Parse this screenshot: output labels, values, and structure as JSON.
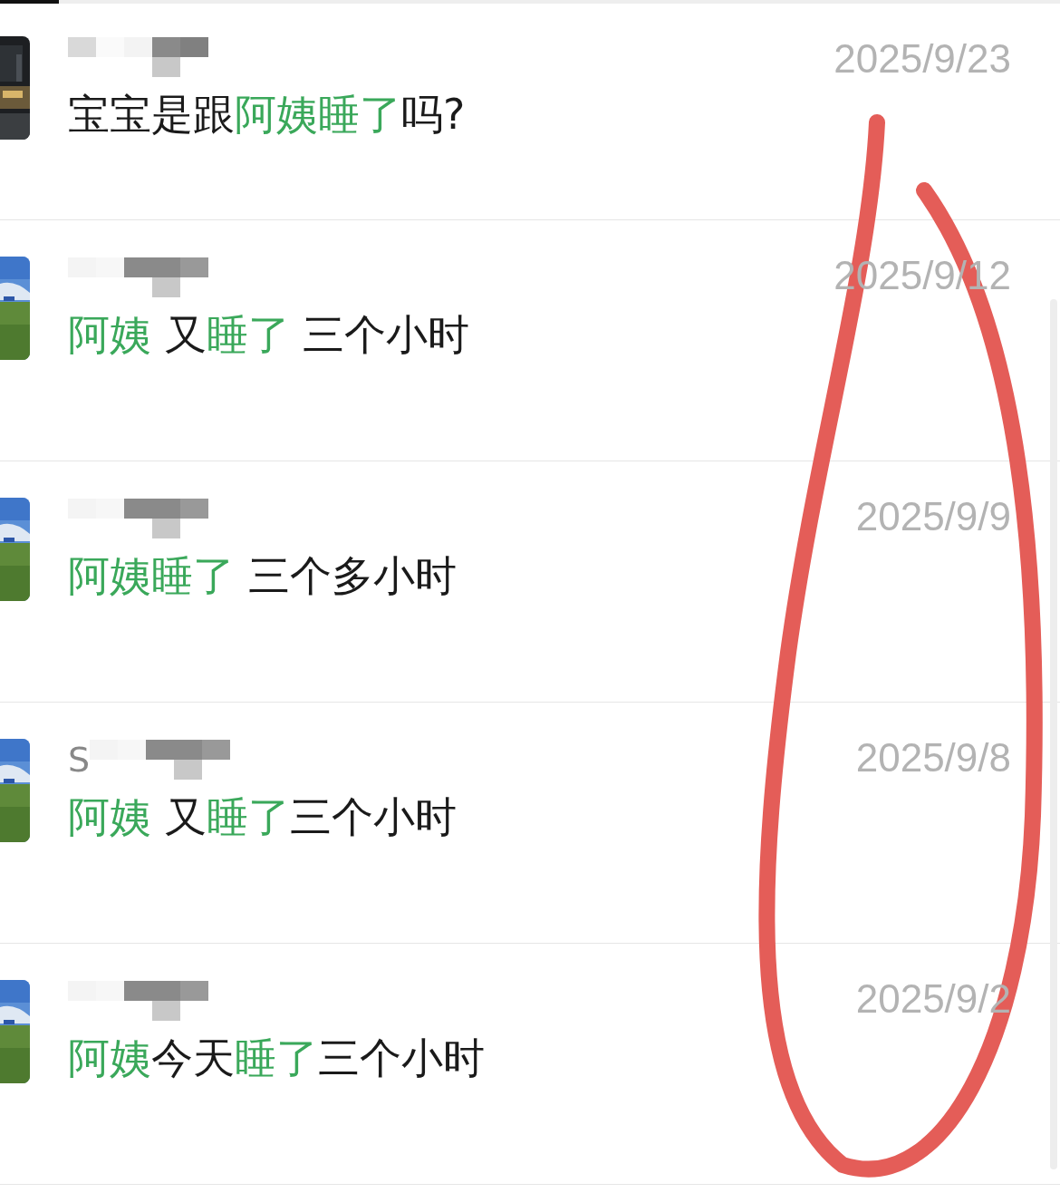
{
  "results": [
    {
      "avatar": {
        "kind": "night"
      },
      "date": "2025/9/23",
      "message": [
        {
          "text": "宝宝是跟",
          "highlight": false
        },
        {
          "text": "阿姨睡了",
          "highlight": true
        },
        {
          "text": "吗?",
          "highlight": false
        }
      ]
    },
    {
      "avatar": {
        "kind": "field"
      },
      "date": "2025/9/12",
      "message": [
        {
          "text": "阿姨",
          "highlight": true
        },
        {
          "text": " 又",
          "highlight": false
        },
        {
          "text": "睡了",
          "highlight": true
        },
        {
          "text": " 三个小时",
          "highlight": false
        }
      ]
    },
    {
      "avatar": {
        "kind": "field"
      },
      "date": "2025/9/9",
      "message": [
        {
          "text": "阿姨睡了",
          "highlight": true
        },
        {
          "text": " 三个多小时",
          "highlight": false
        }
      ]
    },
    {
      "avatar": {
        "kind": "field"
      },
      "name": "S",
      "date": "2025/9/8",
      "message": [
        {
          "text": "阿姨",
          "highlight": true
        },
        {
          "text": " 又",
          "highlight": false
        },
        {
          "text": "睡了",
          "highlight": true
        },
        {
          "text": "三个小时",
          "highlight": false
        }
      ]
    },
    {
      "avatar": {
        "kind": "field"
      },
      "date": "2025/9/2",
      "message": [
        {
          "text": "阿姨",
          "highlight": true
        },
        {
          "text": "今天",
          "highlight": false
        },
        {
          "text": "睡了",
          "highlight": true
        },
        {
          "text": "三个小时",
          "highlight": false
        }
      ]
    }
  ]
}
